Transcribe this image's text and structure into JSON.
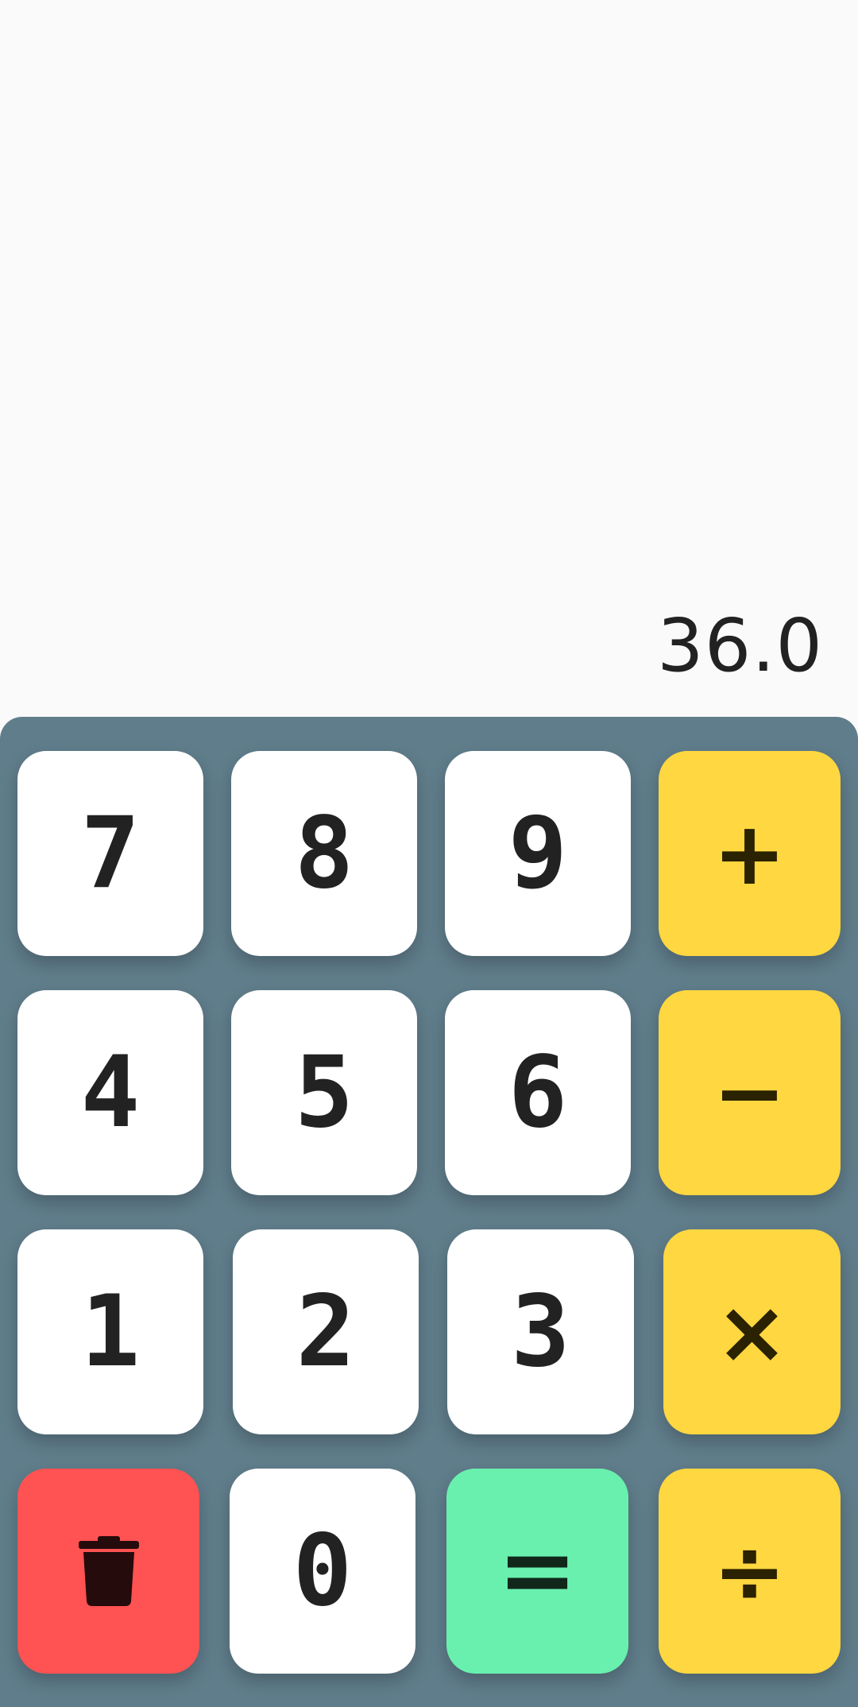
{
  "display": {
    "value": "36.0"
  },
  "keys": {
    "k7": "7",
    "k8": "8",
    "k9": "9",
    "k4": "4",
    "k5": "5",
    "k6": "6",
    "k1": "1",
    "k2": "2",
    "k3": "3",
    "k0": "0",
    "plus": "+",
    "minus": "−",
    "multiply": "×",
    "divide": "÷",
    "equals": "=",
    "clear_icon": "trash-icon"
  },
  "colors": {
    "display_bg": "#fafafa",
    "keypad_bg": "#607d8b",
    "digit_key": "#ffffff",
    "operator_key": "#ffd740",
    "clear_key": "#ff5252",
    "equals_key": "#69f0ae",
    "text": "#222222"
  }
}
